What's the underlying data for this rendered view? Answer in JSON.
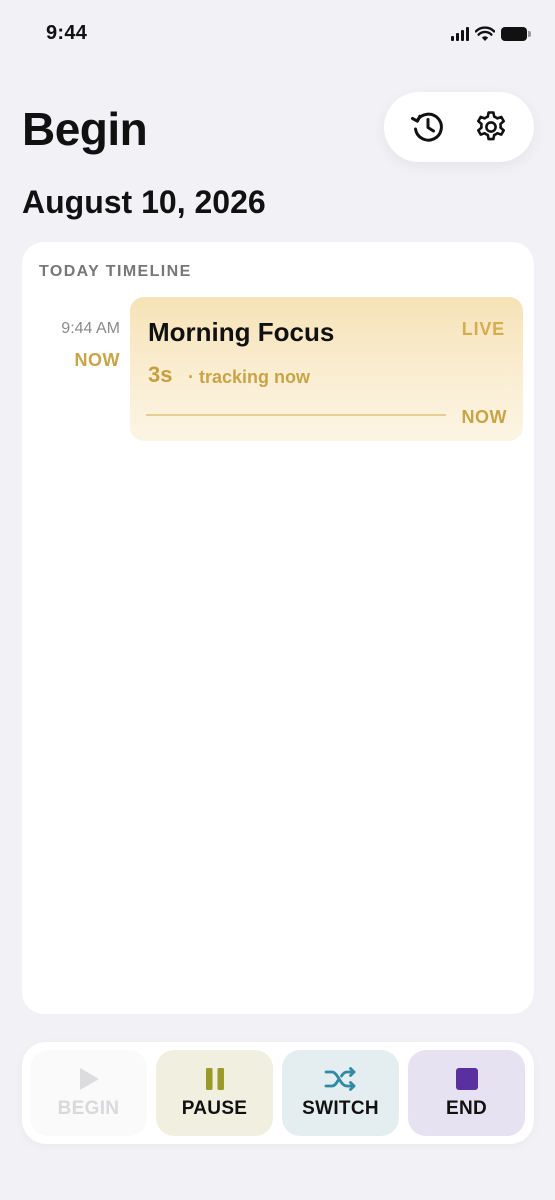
{
  "status_bar": {
    "time": "9:44"
  },
  "header": {
    "title": "Begin",
    "date": "August 10, 2026",
    "actions": [
      {
        "icon": "history-icon"
      },
      {
        "icon": "gear-icon"
      }
    ]
  },
  "timeline": {
    "heading": "TODAY TIMELINE",
    "entries": [
      {
        "time": "9:44 AM",
        "time_marker": "NOW",
        "title": "Morning Focus",
        "badge": "LIVE",
        "duration": "3s",
        "status_text": "· tracking now",
        "end_label": "NOW"
      }
    ]
  },
  "controls": {
    "begin_label": "BEGIN",
    "pause_label": "PAUSE",
    "switch_label": "SWITCH",
    "end_label": "END"
  },
  "colors": {
    "accent_gold": "#c9a447",
    "pause_olive": "#9a9a2a",
    "switch_teal": "#2f8aa6",
    "end_purple": "#5a2fa0"
  }
}
